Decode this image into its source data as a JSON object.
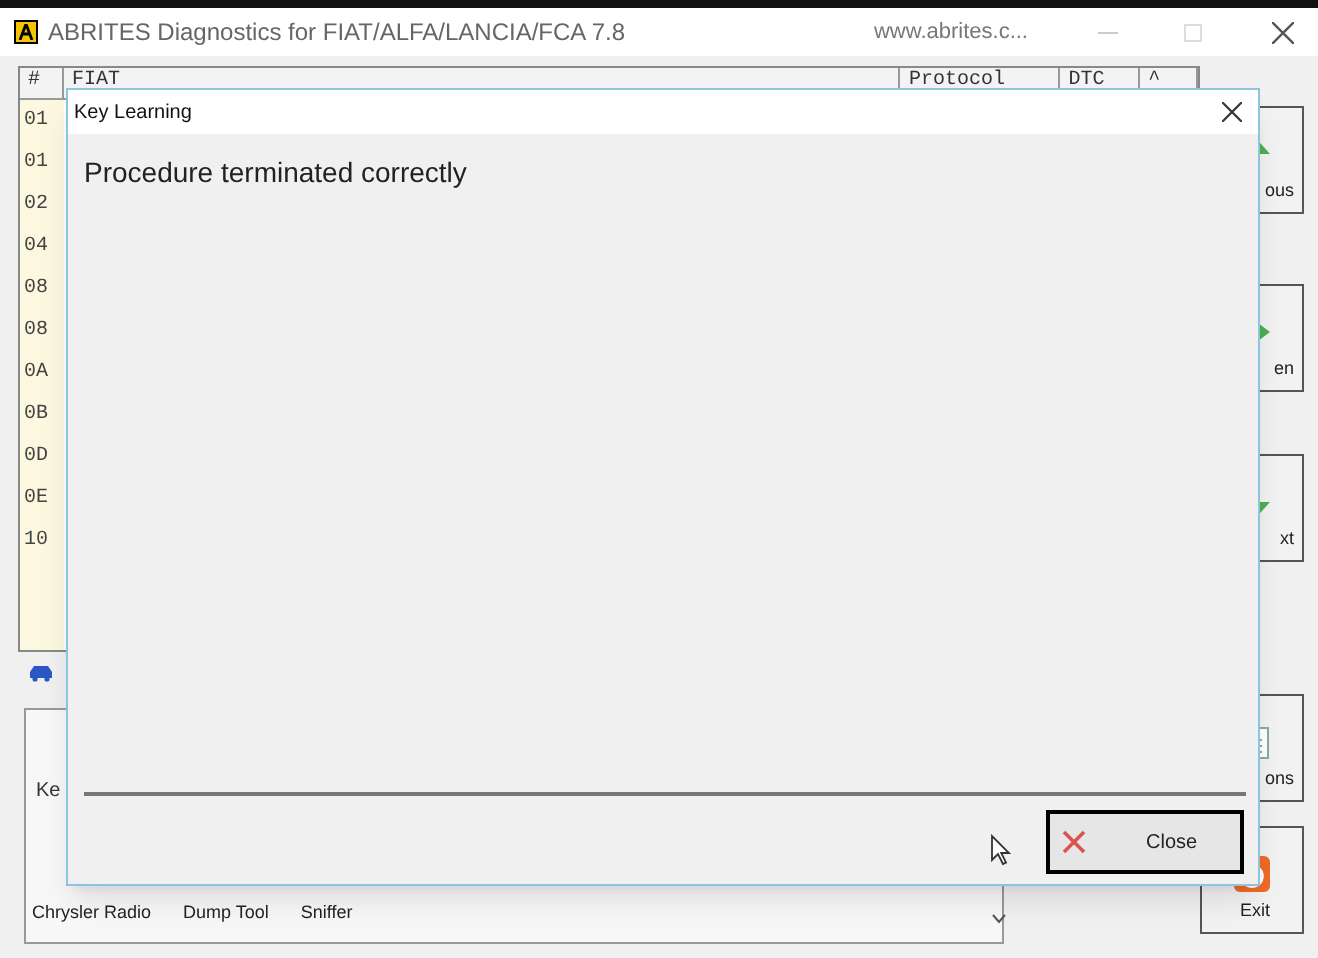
{
  "window": {
    "title": "ABRITES Diagnostics for FIAT/ALFA/LANCIA/FCA 7.8",
    "url": "www.abrites.c..."
  },
  "table": {
    "columns": [
      "#",
      "FIAT",
      "Protocol",
      "DTC",
      "^"
    ],
    "rows": [
      "01",
      "01",
      "02",
      "04",
      "08",
      "08",
      "0A",
      "0B",
      "0D",
      "0E",
      "10"
    ]
  },
  "side_buttons": [
    {
      "label": "ous",
      "kind": "up"
    },
    {
      "label": "en",
      "kind": "right"
    },
    {
      "label": "xt",
      "kind": "down"
    },
    {
      "label": "ons",
      "kind": "doc"
    },
    {
      "label": "Exit",
      "kind": "exit"
    }
  ],
  "bottom_panel": {
    "label": "Ke",
    "tiles": [
      "Chrysler Radio",
      "Dump Tool",
      "Sniffer"
    ]
  },
  "dialog": {
    "title": "Key Learning",
    "message": "Procedure terminated correctly",
    "button": "Close"
  }
}
